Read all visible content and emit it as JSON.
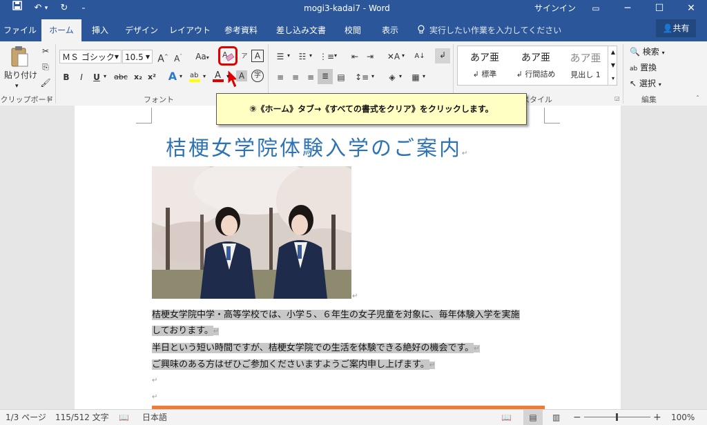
{
  "window": {
    "title": "mogi3-kadai7  -  Word",
    "signin": "サインイン",
    "controls": {
      "ribbon_opts": "▭",
      "minimize": "─",
      "maximize": "☐",
      "close": "✕"
    }
  },
  "qat": {
    "save": "💾",
    "undo": "↶",
    "undo_arrow": "▾",
    "redo": "↻",
    "customize": "₌"
  },
  "tabs": [
    {
      "label": "ファイル"
    },
    {
      "label": "ホーム"
    },
    {
      "label": "挿入"
    },
    {
      "label": "デザイン"
    },
    {
      "label": "レイアウト"
    },
    {
      "label": "参考資料"
    },
    {
      "label": "差し込み文書"
    },
    {
      "label": "校閲"
    },
    {
      "label": "表示"
    }
  ],
  "tell_me": "実行したい作業を入力してください",
  "share_label": "共有",
  "clipboard": {
    "paste": "貼り付け",
    "group_label": "クリップボード"
  },
  "font": {
    "name": "ＭＳ ゴシック",
    "size": "10.5",
    "group_label": "フォント",
    "aa_label": "Aa",
    "bold": "B",
    "italic": "I",
    "underline": "U",
    "strike": "abc",
    "sub": "x₂",
    "sup": "x²"
  },
  "styles": {
    "items": [
      {
        "sample": "あア亜",
        "name": "↲ 標準"
      },
      {
        "sample": "あア亜",
        "name": "↲ 行間詰め"
      },
      {
        "sample": "あア亜",
        "name": "見出し 1"
      }
    ],
    "group_label": "スタイル"
  },
  "editing": {
    "find": "検索",
    "replace": "置換",
    "select": "選択",
    "group_label": "編集"
  },
  "callout": "⑨《ホーム》タブ→《すべての書式をクリア》をクリックします。",
  "document": {
    "title": "桔梗女学院体験入学のご案内",
    "paragraphs": [
      "桔梗女学院中学・高等学校では、小学５、６年生の女子児童を対象に、毎年体験入学を実施",
      "しております。",
      "半日という短い時間ですが、桔梗女学院での生活を体験できる絶好の機会です。",
      "ご興味のある方はぜひご参加くださいますようご案内申し上げます。"
    ],
    "para_mark": "↵"
  },
  "status": {
    "page": "1/3 ページ",
    "words": "115/512 文字",
    "language": "日本語",
    "zoom": "100%"
  },
  "colors": {
    "accent": "#2b579a",
    "title": "#2e74b5",
    "highlight_box": "#e00000"
  }
}
